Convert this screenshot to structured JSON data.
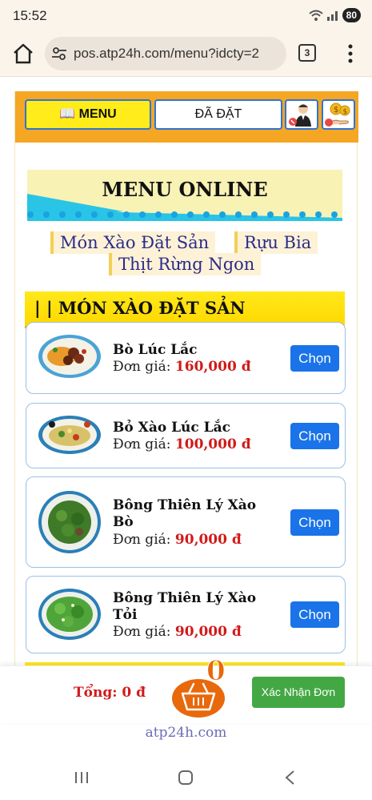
{
  "status_bar": {
    "time": "15:52",
    "battery": "80"
  },
  "browser": {
    "url": "pos.atp24h.com/menu?idcty=2",
    "tab_count": "3"
  },
  "nav": {
    "menu_tab": "📖 MENU",
    "ordered_tab": "ĐÃ ĐẶT"
  },
  "banner": {
    "title": "MENU ONLINE"
  },
  "categories": [
    "Món Xào Đặt Sản",
    "Rựu Bia",
    "Thịt Rừng Ngon"
  ],
  "section": {
    "title": "| | MÓN XÀO ĐẶT SẢN"
  },
  "items": [
    {
      "name": "Bò Lúc Lắc",
      "price_label": "Đơn giá:",
      "price": "160,000 đ",
      "choose": "Chọn"
    },
    {
      "name": "Bỏ Xào Lúc Lắc",
      "price_label": "Đơn giá:",
      "price": "100,000 đ",
      "choose": "Chọn"
    },
    {
      "name": "Bông Thiên Lý Xào Bò",
      "price_label": "Đơn giá:",
      "price": "90,000 đ",
      "choose": "Chọn"
    },
    {
      "name": "Bông Thiên Lý Xào Tỏi",
      "price_label": "Đơn giá:",
      "price": "90,000 đ",
      "choose": "Chọn"
    }
  ],
  "cart": {
    "total": "Tổng: 0 đ",
    "count": "0",
    "confirm": "Xác Nhận Đơn"
  },
  "footer": {
    "brand": "atp24h.com"
  },
  "colors": {
    "accent_orange": "#f5a623",
    "menu_yellow": "#ffec1a",
    "price_red": "#d11a1a",
    "button_blue": "#1a73e8",
    "confirm_green": "#43a843"
  }
}
